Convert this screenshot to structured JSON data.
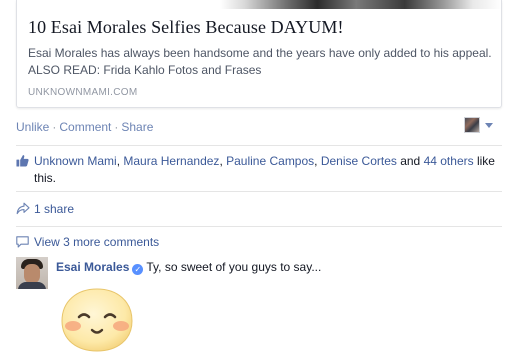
{
  "link_preview": {
    "title": "10 Esai Morales Selfies Because DAYUM!",
    "description": "Esai Morales has always been handsome and the years have only added to his appeal. ALSO READ: Frida Kahlo Fotos and Frases",
    "domain": "UNKNOWNMAMI.COM"
  },
  "actions": {
    "unlike": "Unlike",
    "comment": "Comment",
    "share": "Share",
    "separator": "·"
  },
  "likes": {
    "names": [
      "Unknown Mami",
      "Maura Hernandez",
      "Pauline Campos",
      "Denise Cortes"
    ],
    "comma": ", ",
    "and": " and ",
    "others": "44 others",
    "suffix": " like this.",
    "icon": "thumbs-up-icon"
  },
  "shares": {
    "label": "1 share",
    "icon": "share-arrow-icon"
  },
  "comments": {
    "more_label": "View 3 more comments",
    "icon": "speech-bubble-icon",
    "items": [
      {
        "author": "Esai Morales",
        "verified_mark": "✓",
        "text": "Ty, so sweet of you guys to say...",
        "sticker": "blushing-smiley-sticker"
      }
    ]
  },
  "colors": {
    "link": "#3b5998",
    "action_link": "#6d84b4",
    "muted": "#9197a3",
    "verified": "#5890ff",
    "sticker_face": "#fde9a8",
    "sticker_blush": "#f6a77e"
  }
}
